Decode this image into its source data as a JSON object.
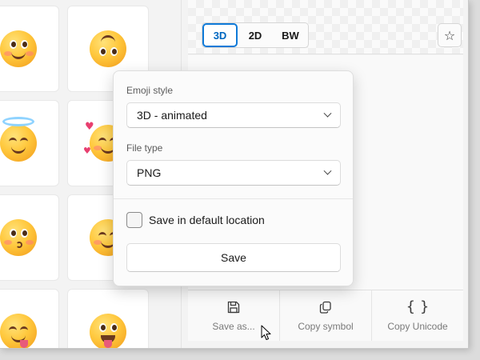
{
  "style_segment": {
    "options": [
      "3D",
      "2D",
      "BW"
    ],
    "selected": "3D",
    "accent": "#0f7ad8"
  },
  "favorite_icon": "star-outline-icon",
  "flyout": {
    "emoji_style_label": "Emoji style",
    "emoji_style_value": "3D - animated",
    "file_type_label": "File type",
    "file_type_value": "PNG",
    "default_location_label": "Save in default location",
    "default_location_checked": false,
    "save_label": "Save"
  },
  "actions": [
    {
      "label": "Save as...",
      "icon": "save-icon"
    },
    {
      "label": "Copy symbol",
      "icon": "copy-icon"
    },
    {
      "label": "Copy Unicode",
      "icon": "braces-icon"
    }
  ],
  "emoji_grid": [
    "smiling-face-icon",
    "upside-down-face-icon",
    "smiling-face-with-halo-icon",
    "smiling-face-with-hearts-icon",
    "kissing-face-icon",
    "smiling-face-with-smiling-eyes-icon",
    "face-savoring-food-icon",
    "grinning-face-with-tongue-icon"
  ]
}
